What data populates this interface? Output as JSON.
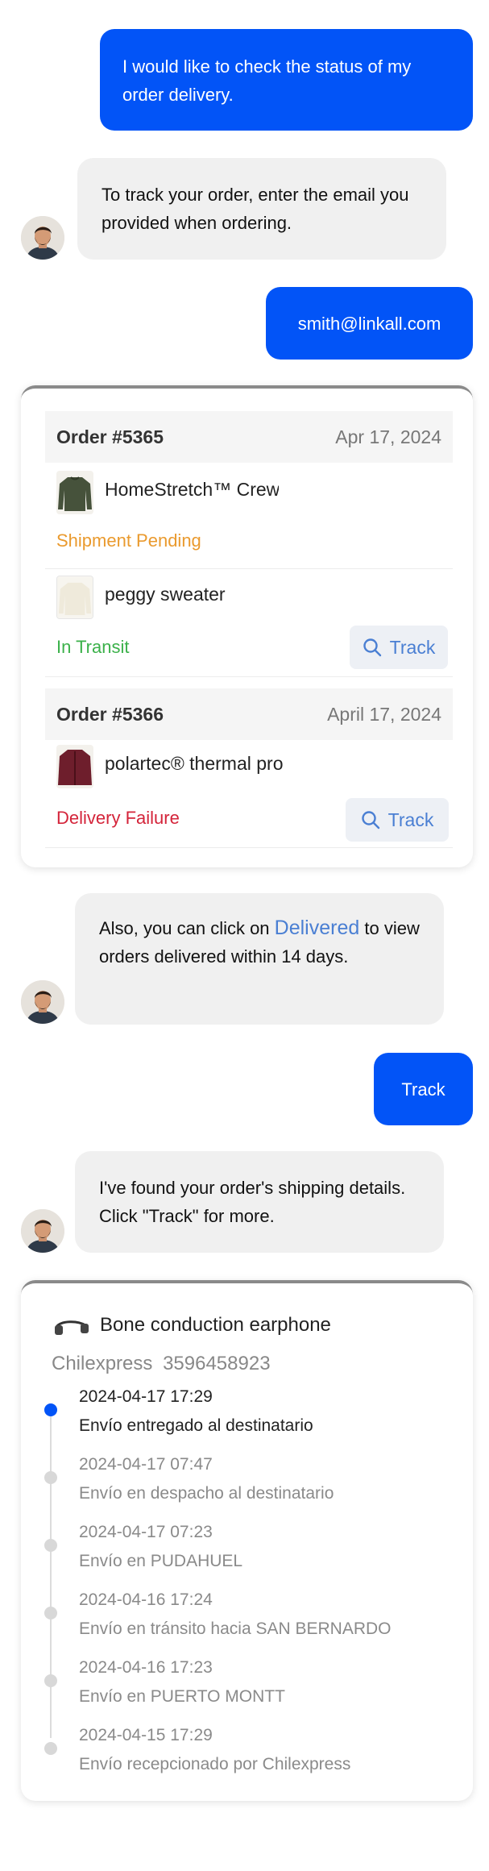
{
  "colors": {
    "user_bubble": "#0254f7",
    "bot_bubble": "#f0f0f0",
    "pending": "#ea9a2e",
    "in_transit": "#3bb14a",
    "failure": "#d4243a",
    "link": "#4a7fd3",
    "timeline_active": "#0254f7",
    "timeline_inactive": "#d8d8d8"
  },
  "messages": {
    "user_1": "I would like to check the status of my order delivery.",
    "bot_1": "To track your order, enter the email you provided when ordering.",
    "user_2": "smith@linkall.com",
    "bot_2_prefix": "Also, you can click on",
    "bot_2_link": "Delivered",
    "bot_2_suffix": "to view orders delivered within 14 days.",
    "user_3": "Track",
    "bot_3": "I've found your order's shipping details. Click \"Track\" for more."
  },
  "orders": [
    {
      "id": "Order #5365",
      "date": "Apr 17, 2024",
      "items": [
        {
          "name": "HomeStretch™ Crew",
          "thumb_icon": "green-sweater-thumbnail",
          "status": "Shipment Pending"
        },
        {
          "name": "peggy sweater",
          "thumb_icon": "cream-sweater-thumbnail",
          "status": "In Transit",
          "action": "Track"
        }
      ]
    },
    {
      "id": "Order #5366",
      "date": "April 17, 2024",
      "items": [
        {
          "name": "polartec® thermal pro",
          "thumb_icon": "maroon-jacket-thumbnail",
          "status": "Delivery Failure",
          "action": "Track"
        }
      ]
    }
  ],
  "shipment": {
    "product": "Bone conduction earphone",
    "product_icon": "earphone-icon",
    "carrier": "Chilexpress",
    "tracking_number": "3596458923",
    "events": [
      {
        "time": "2024-04-17 17:29",
        "desc": "Envío entregado al destinatario",
        "active": true
      },
      {
        "time": "2024-04-17 07:47",
        "desc": "Envío en despacho al destinatario",
        "active": false
      },
      {
        "time": "2024-04-17 07:23",
        "desc": "Envío en PUDAHUEL",
        "active": false
      },
      {
        "time": "2024-04-16 17:24",
        "desc": "Envío en tránsito hacia SAN BERNARDO",
        "active": false
      },
      {
        "time": "2024-04-16 17:23",
        "desc": "Envío en PUERTO MONTT",
        "active": false
      },
      {
        "time": "2024-04-15 17:29",
        "desc": "Envío recepcionado por Chilexpress",
        "active": false
      }
    ]
  }
}
